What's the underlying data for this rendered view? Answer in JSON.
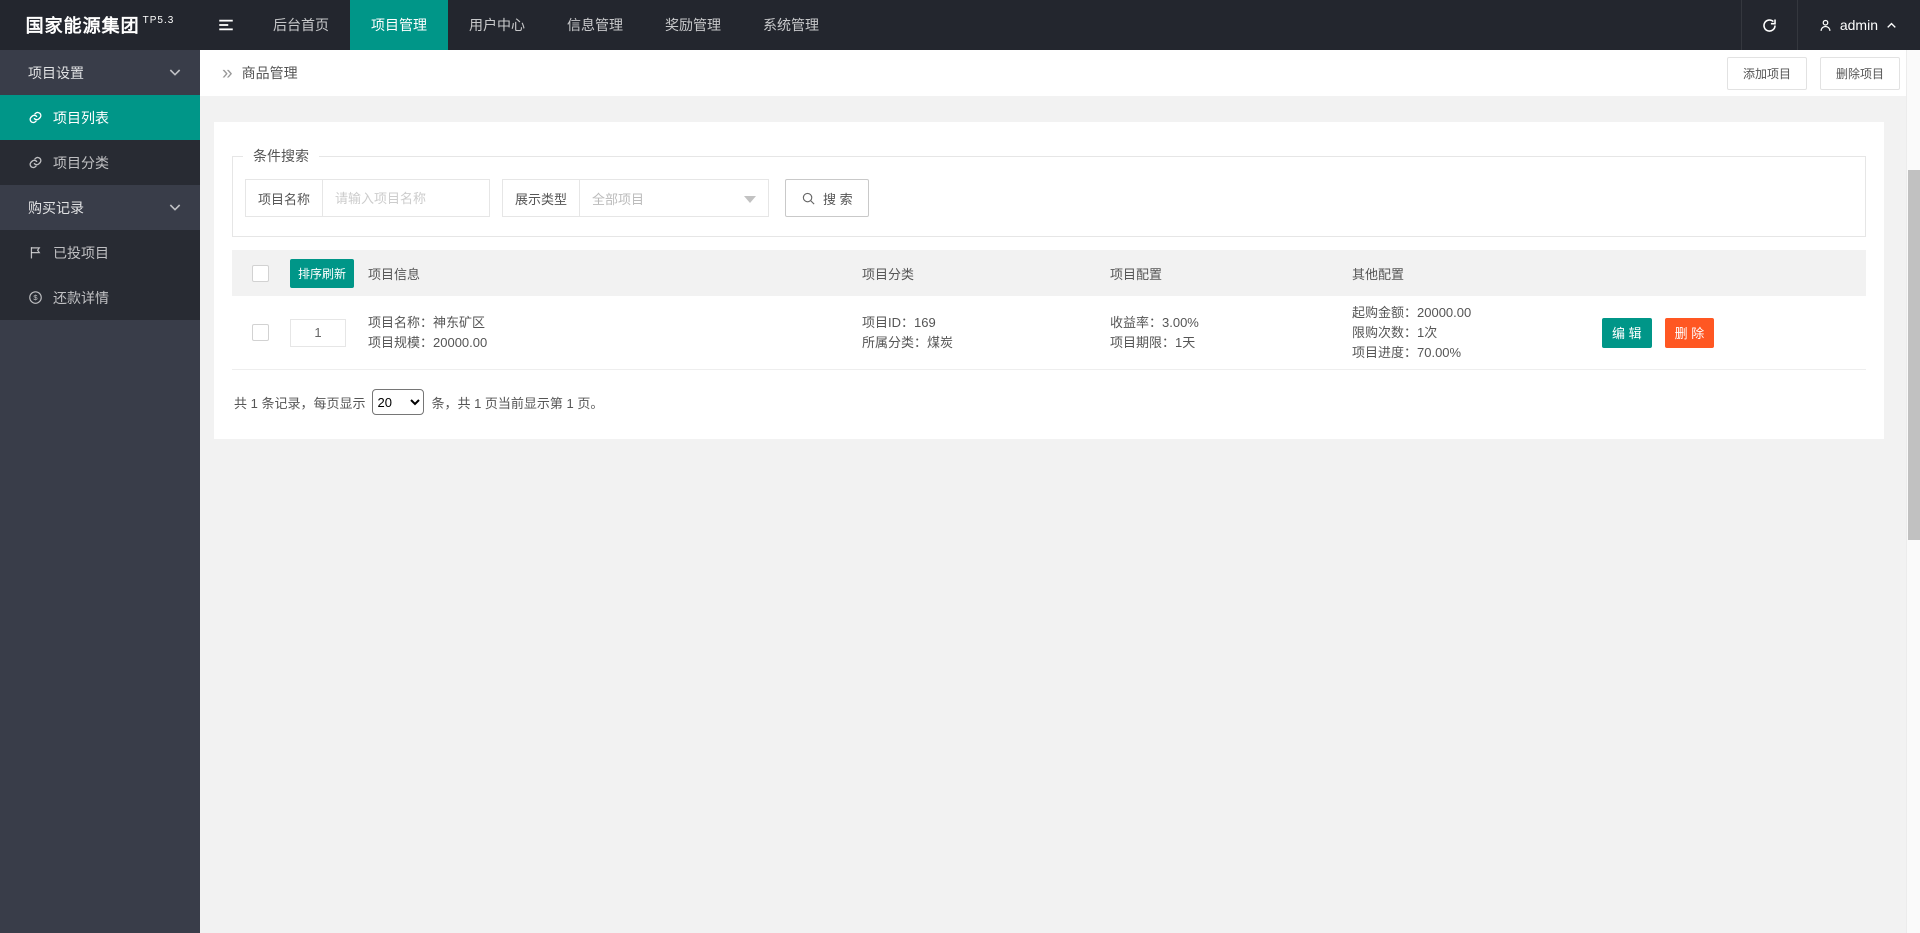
{
  "colors": {
    "accent": "#009688",
    "danger": "#ff5722",
    "header_bg": "#23262e",
    "sidebar_bg": "#393d49"
  },
  "header": {
    "logo": "国家能源集团",
    "logo_sup": "TP5.3",
    "nav": [
      "后台首页",
      "项目管理",
      "用户中心",
      "信息管理",
      "奖励管理",
      "系统管理"
    ],
    "active_nav": "项目管理",
    "username": "admin"
  },
  "sidebar": {
    "items": [
      {
        "label": "项目设置",
        "type": "group"
      },
      {
        "label": "项目列表",
        "active": true,
        "icon": "link-icon"
      },
      {
        "label": "项目分类",
        "icon": "link-icon"
      },
      {
        "label": "购买记录",
        "type": "group"
      },
      {
        "label": "已投项目",
        "icon": "flag-icon"
      },
      {
        "label": "还款详情",
        "icon": "dollar-circle-icon"
      }
    ]
  },
  "breadcrumb": {
    "arrow": "»",
    "title": "商品管理"
  },
  "toolbar": {
    "add_label": "添加项目",
    "delete_label": "删除项目"
  },
  "search": {
    "legend": "条件搜索",
    "name_label": "项目名称",
    "name_placeholder": "请输入项目名称",
    "name_value": "",
    "type_label": "展示类型",
    "type_value": "全部项目",
    "search_label": "搜 索"
  },
  "table": {
    "sort_button": "排序刷新",
    "columns": [
      "项目信息",
      "项目分类",
      "项目配置",
      "其他配置"
    ],
    "rows": [
      {
        "sort": "1",
        "info": [
          "项目名称：神东矿区",
          "项目规模：20000.00"
        ],
        "category": [
          "项目ID：169",
          "所属分类：煤炭"
        ],
        "config": [
          "收益率：3.00%",
          "项目期限：1天"
        ],
        "other": [
          "起购金额：20000.00",
          "限购次数：1次",
          "项目进度：70.00%"
        ],
        "edit_label": "编 辑",
        "delete_label": "删 除"
      }
    ]
  },
  "pagination": {
    "prefix": "共 1 条记录，每页显示",
    "page_size": "20",
    "suffix": "条，共 1 页当前显示第 1 页。"
  }
}
